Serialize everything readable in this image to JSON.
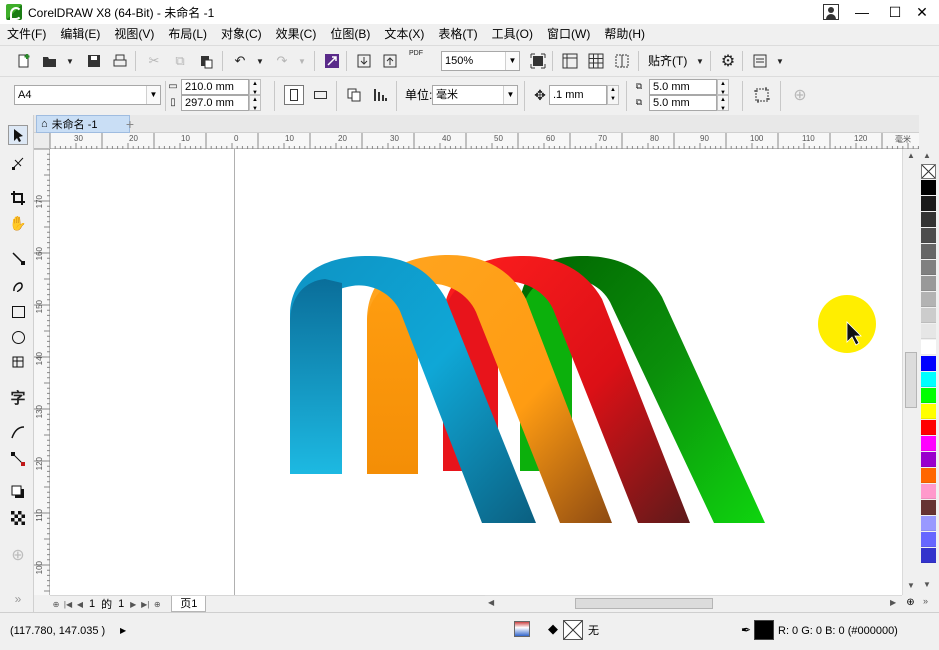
{
  "window": {
    "title": "CorelDRAW X8 (64-Bit) - 未命名 -1",
    "controls": {
      "minimize": "—",
      "maximize": "☐",
      "close": "✕"
    }
  },
  "menu": [
    "文件(F)",
    "编辑(E)",
    "视图(V)",
    "布局(L)",
    "对象(C)",
    "效果(C)",
    "位图(B)",
    "文本(X)",
    "表格(T)",
    "工具(O)",
    "窗口(W)",
    "帮助(H)"
  ],
  "toolbar_standard": {
    "zoom_value": "150%",
    "snap_label": "贴齐(T)",
    "pdf_label": "PDF"
  },
  "toolbar_property": {
    "page_size": "A4",
    "width": "210.0 mm",
    "height": "297.0 mm",
    "units_label": "单位:",
    "units_value": "毫米",
    "nudge": ".1 mm",
    "dup_x": "5.0 mm",
    "dup_y": "5.0 mm"
  },
  "document_tab": {
    "label": "未命名 -1",
    "new_tab": "+"
  },
  "ruler": {
    "h_labels": [
      "30",
      "20",
      "10",
      "0",
      "10",
      "20",
      "30",
      "40",
      "50",
      "60",
      "70",
      "80",
      "90",
      "100",
      "110",
      "120"
    ],
    "h_unit": "毫米",
    "v_labels": [
      "170",
      "160",
      "150",
      "140",
      "130",
      "120",
      "110",
      "100"
    ]
  },
  "page_navigator": {
    "current": "1",
    "of": "的",
    "total": "1",
    "page_tab": "页1"
  },
  "status": {
    "coords": "(117.780, 147.035 )",
    "fill_label": "无",
    "color_readout": "R: 0 G: 0 B: 0 (#000000)"
  },
  "palette": [
    "#000000",
    "#1a1a1a",
    "#333333",
    "#4d4d4d",
    "#666666",
    "#808080",
    "#999999",
    "#b3b3b3",
    "#cccccc",
    "#e6e6e6",
    "#ffffff",
    "#0000ff",
    "#00ffff",
    "#00ff00",
    "#ffff00",
    "#ff0000",
    "#ff00ff",
    "#9900cc",
    "#ff6600",
    "#ff99cc",
    "#663333",
    "#9999ff",
    "#6666ff",
    "#3333cc"
  ],
  "colors": {
    "accent_blue": "#0e86b4",
    "orange": "#ff9a12",
    "red": "#e8141b",
    "green": "#0cb70c",
    "cursor_highlight": "#ffee00"
  }
}
